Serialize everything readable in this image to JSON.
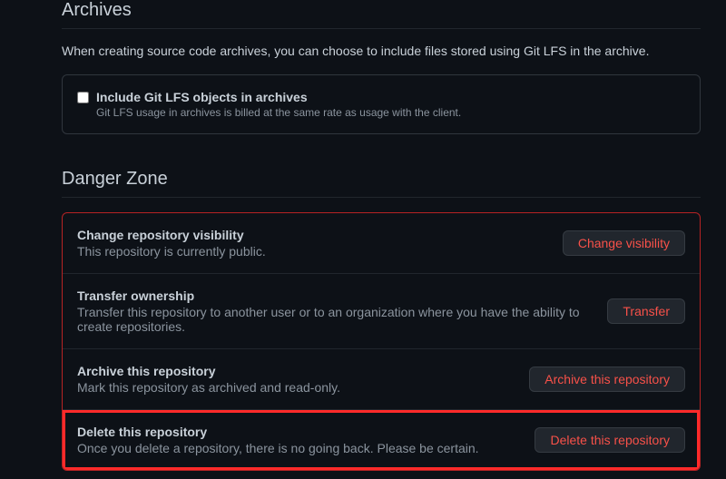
{
  "archives": {
    "header": "Archives",
    "description": "When creating source code archives, you can choose to include files stored using Git LFS in the archive.",
    "lfs_label": "Include Git LFS objects in archives",
    "lfs_note": "Git LFS usage in archives is billed at the same rate as usage with the client."
  },
  "danger": {
    "header": "Danger Zone",
    "items": [
      {
        "title": "Change repository visibility",
        "desc": "This repository is currently public.",
        "button": "Change visibility"
      },
      {
        "title": "Transfer ownership",
        "desc": "Transfer this repository to another user or to an organization where you have the ability to create repositories.",
        "button": "Transfer"
      },
      {
        "title": "Archive this repository",
        "desc": "Mark this repository as archived and read-only.",
        "button": "Archive this repository"
      },
      {
        "title": "Delete this repository",
        "desc": "Once you delete a repository, there is no going back. Please be certain.",
        "button": "Delete this repository"
      }
    ]
  }
}
